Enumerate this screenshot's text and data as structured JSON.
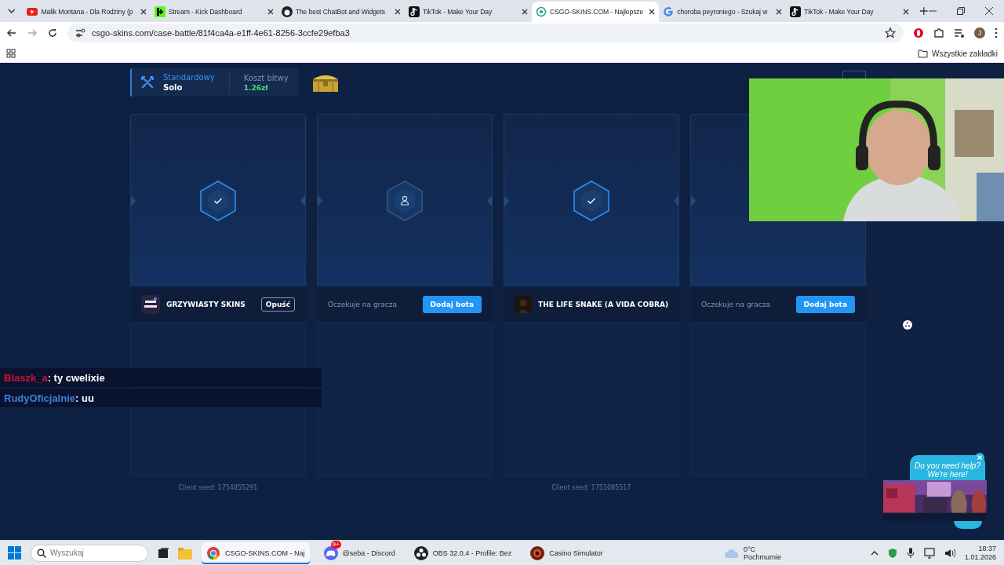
{
  "browser": {
    "tabs": [
      {
        "title": "Malik Montana - Dla Rodziny (p",
        "kind": "video",
        "selected": false
      },
      {
        "title": "Stream - Kick Dashboard",
        "kind": "kick",
        "selected": false
      },
      {
        "title": "The best ChatBot and Widgets",
        "kind": "cat",
        "selected": false
      },
      {
        "title": "TikTok - Make Your Day",
        "kind": "note",
        "selected": false
      },
      {
        "title": "CSGO-SKINS.COM - Najlepsze",
        "kind": "globe",
        "selected": true
      },
      {
        "title": "choroba peyroniego - Szukaj w",
        "kind": "google",
        "selected": false
      },
      {
        "title": "TikTok - Make Your Day",
        "kind": "note",
        "selected": false
      }
    ],
    "url": "csgo-skins.com/case-battle/81f4ca4a-e1ff-4e61-8256-3ccfe29efba3",
    "profile": "J",
    "bookmarks": "Wszystkie zakładki"
  },
  "battle": {
    "mode": "Standardowy",
    "type": "Solo",
    "cost_label": "Koszt bitwy",
    "cost": "1.26zł",
    "slots": [
      {
        "kind": "player",
        "name": "GRZYWIASTY SKINS",
        "button": "Opuść",
        "seed": "Client seed: 1754855291"
      },
      {
        "kind": "empty",
        "text": "Oczekuje na gracza",
        "button": "Dodaj bota"
      },
      {
        "kind": "player",
        "name": "THE LIFE SNAKE (A VIDA COBRA)",
        "seed": "Client seed: 1751085517"
      },
      {
        "kind": "empty",
        "text": "Oczekuje na gracza",
        "button": "Dodaj bota"
      }
    ]
  },
  "chat": [
    {
      "user": "Blaszk_a",
      "text": ": ty cwelixie",
      "color": "#d0103a"
    },
    {
      "user": "RudyOficjalnie",
      "text": ": uu",
      "color": "#3d7fd9"
    }
  ],
  "help": {
    "text": "Do you need help? We're here!"
  },
  "taskbar": {
    "placeholder": "Wyszukaj",
    "apps": [
      {
        "label": "CSGO-SKINS.COM - Naj",
        "kind": "chrome",
        "selected": true
      },
      {
        "label": "@seba - Discord",
        "kind": "discord",
        "badge": "9+",
        "selected": false
      },
      {
        "label": "OBS 32.0.4 - Profile: Bez",
        "kind": "obs",
        "selected": false
      },
      {
        "label": "Casino Simulator",
        "kind": "casino",
        "selected": false
      }
    ],
    "weather": {
      "temp": "0°C",
      "condition": "Pochmurnie"
    },
    "time": "18:37",
    "date": "1.01.2026"
  }
}
